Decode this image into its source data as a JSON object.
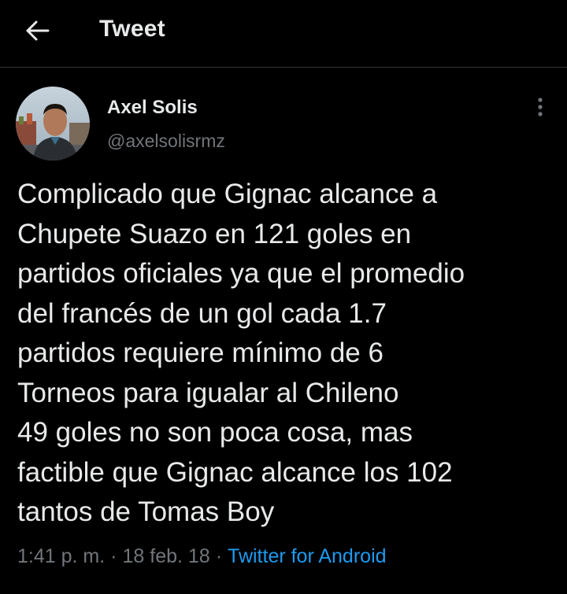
{
  "header": {
    "back_icon": "arrow-left-icon",
    "title": "Tweet"
  },
  "tweet": {
    "author": {
      "display_name": "Axel Solis",
      "handle": "@axelsolisrmz",
      "avatar": "avatar-photo"
    },
    "more_icon": "more-vertical-icon",
    "text": "Complicado que Gignac alcance a\nChupete Suazo en 121 goles en\npartidos oficiales ya que el promedio\ndel francés de un gol cada 1.7\npartidos requiere mínimo de 6\nTorneos para igualar al Chileno\n49 goles no son poca cosa, mas\nfactible que Gignac alcance los 102\ntantos de Tomas Boy",
    "time": "1:41 p. m.",
    "separator": "·",
    "date": "18 feb. 18",
    "source": "Twitter for Android"
  },
  "colors": {
    "background": "#000000",
    "text": "#e7e9ea",
    "secondary": "#71767b",
    "link": "#1d9bf0",
    "divider": "#2f3336"
  }
}
